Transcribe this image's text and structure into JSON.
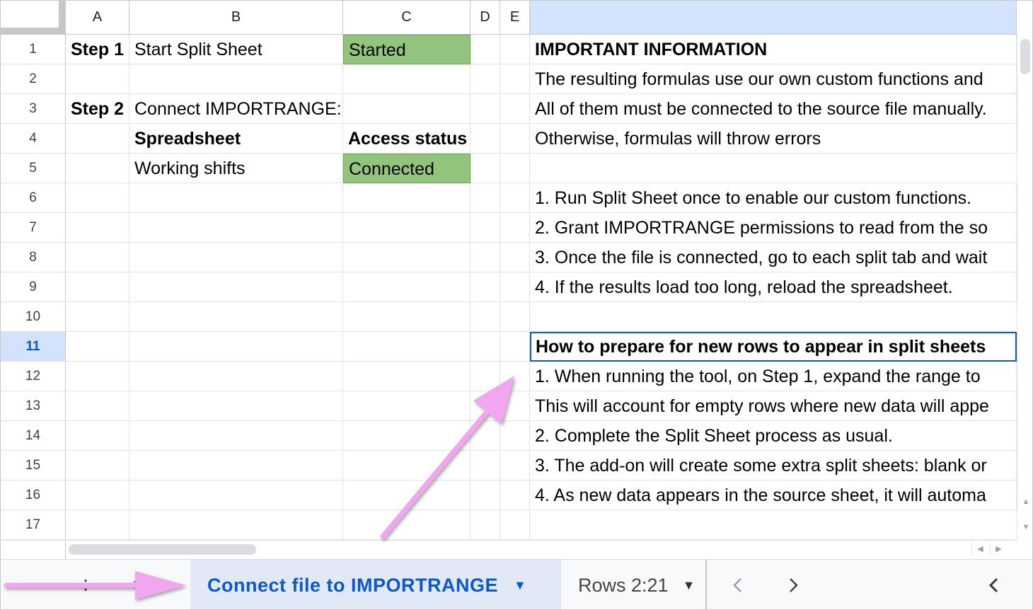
{
  "columns": [
    "A",
    "B",
    "C",
    "D",
    "E",
    ""
  ],
  "rows": [
    "1",
    "2",
    "3",
    "4",
    "5",
    "6",
    "7",
    "8",
    "9",
    "10",
    "11",
    "12",
    "13",
    "14",
    "15",
    "16",
    "17"
  ],
  "selected_row": "11",
  "cells": {
    "a1": "Step 1",
    "b1": "Start Split Sheet",
    "c1": "Started",
    "a3": "Step 2",
    "b3": "Connect IMPORTRANGE:",
    "b4": "Spreadsheet",
    "c4": "Access status",
    "b5": "Working shifts",
    "c5": "Connected",
    "f1": "IMPORTANT INFORMATION",
    "f2": "The resulting formulas use our own custom functions and",
    "f3": "All of them must be connected to the source file manually.",
    "f4": "Otherwise, formulas will throw errors",
    "f6": "1. Run Split Sheet once to enable our custom functions.",
    "f7": "2. Grant IMPORTRANGE permissions to read from the so",
    "f8": "3. Once the file is connected, go to each split tab and wait",
    "f9": "4. If the results load too long, reload the spreadsheet.",
    "f11": "How to prepare for new rows to appear in split sheets",
    "f12": "1. When running the tool, on Step 1, expand the range to",
    "f13": "This will account for empty rows where new data will appe",
    "f14": "2. Complete the Split Sheet process as usual.",
    "f15": "3. The add-on will create some extra split sheets: blank or",
    "f16": "4. As new data appears in the source sheet, it will automa"
  },
  "tabs": {
    "active_label": "Connect file to IMPORTRANGE",
    "second_label": "Rows 2:21"
  },
  "colors": {
    "accent": "#0b57d0",
    "status_green": "#93c47d",
    "arrow": "#f3a6f0",
    "selected_header": "#d3e3fd"
  },
  "icons": [
    "dropdown-caret-icon",
    "chevron-left-icon",
    "chevron-right-icon",
    "scroll-up-icon",
    "scroll-down-icon",
    "scroll-left-icon",
    "scroll-right-icon"
  ]
}
